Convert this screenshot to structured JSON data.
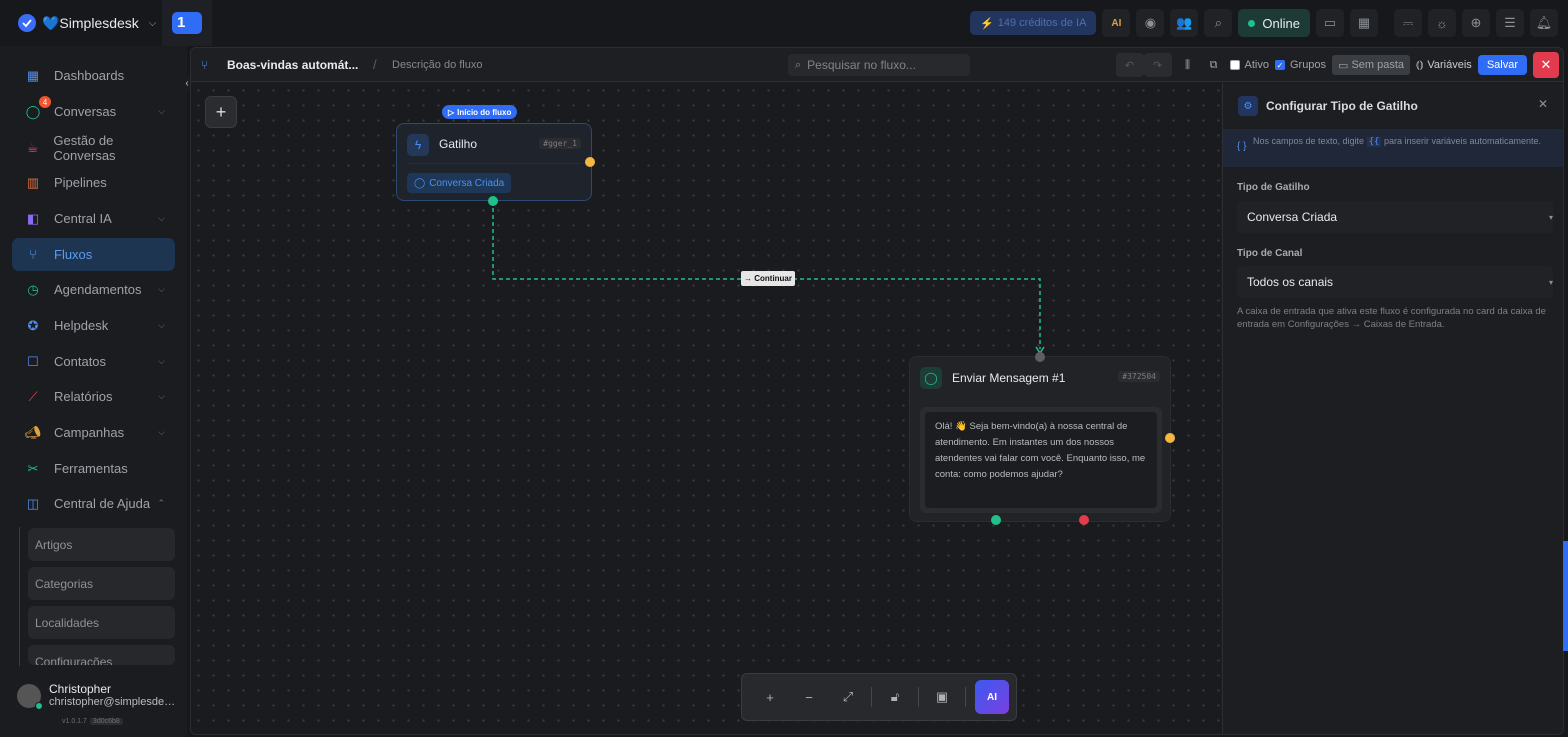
{
  "app": {
    "brand": "💙Simplesdesk",
    "workspace_badge": "1"
  },
  "topbar": {
    "credits": "149 créditos de IA",
    "status": "Online"
  },
  "sidebar": {
    "items": [
      {
        "label": "Dashboards",
        "icon": "dashboard-icon"
      },
      {
        "label": "Conversas",
        "icon": "chat-icon",
        "badge": "4"
      },
      {
        "label": "Gestão de Conversas",
        "icon": "coffee-icon"
      },
      {
        "label": "Pipelines",
        "icon": "pipeline-icon"
      },
      {
        "label": "Central IA",
        "icon": "ai-icon"
      },
      {
        "label": "Fluxos",
        "icon": "flow-icon"
      },
      {
        "label": "Agendamentos",
        "icon": "calendar-icon"
      },
      {
        "label": "Helpdesk",
        "icon": "helpdesk-icon"
      },
      {
        "label": "Contatos",
        "icon": "contacts-icon"
      },
      {
        "label": "Relatórios",
        "icon": "chart-icon"
      },
      {
        "label": "Campanhas",
        "icon": "megaphone-icon"
      },
      {
        "label": "Ferramentas",
        "icon": "tools-icon"
      },
      {
        "label": "Central de Ajuda",
        "icon": "book-icon"
      }
    ],
    "subitems": [
      "Artigos",
      "Categorias",
      "Localidades",
      "Configurações"
    ],
    "user": {
      "name": "Christopher",
      "email": "christopher@simplesdesk.com",
      "version": "v1.0.1.7",
      "build": "3d0c6b8"
    }
  },
  "header": {
    "title": "Boas-vindas automát...",
    "description": "Descrição do fluxo",
    "search_placeholder": "Pesquisar no fluxo...",
    "active_label": "Ativo",
    "groups_label": "Grupos",
    "folder_label": "Sem pasta",
    "variables_label": "Variáveis",
    "save_label": "Salvar"
  },
  "canvas": {
    "start_label": "Início do fluxo",
    "trigger": {
      "title": "Gatilho",
      "id": "#gger_1",
      "chip": "Conversa Criada"
    },
    "edge_label": "→ Continuar",
    "message": {
      "title": "Enviar Mensagem #1",
      "id": "#372504",
      "text": "Olá! 👋 Seja bem-vindo(a) à nossa central de atendimento. Em instantes um dos nossos atendentes vai falar com você. Enquanto isso, me conta: como podemos ajudar?"
    }
  },
  "panel": {
    "title": "Configurar Tipo de Gatilho",
    "info_a": "Nos campos de texto, digite",
    "info_code": "{{",
    "info_b": "para inserir variáveis automaticamente.",
    "trigger_type_label": "Tipo de Gatilho",
    "trigger_type_value": "Conversa Criada",
    "channel_type_label": "Tipo de Canal",
    "channel_type_value": "Todos os canais",
    "note": "A caixa de entrada que ativa este fluxo é configurada no card da caixa de entrada em Configurações → Caixas de Entrada."
  },
  "colors": {
    "accent": "#2f6df6",
    "success": "#21c08b",
    "warning": "#f5b642",
    "danger": "#e23b4e"
  }
}
